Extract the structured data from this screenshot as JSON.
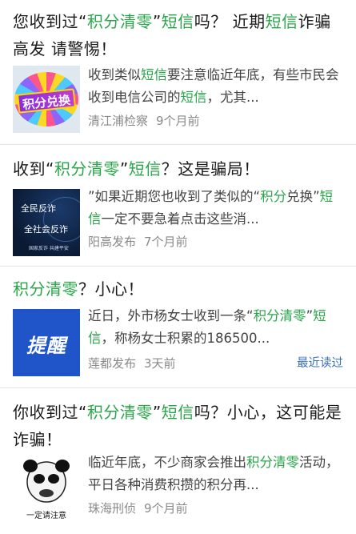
{
  "articles": [
    {
      "title_parts": [
        {
          "text": "您收到过“",
          "hl": false
        },
        {
          "text": "积分清零",
          "hl": true
        },
        {
          "text": "”",
          "hl": false
        },
        {
          "text": "短信",
          "hl": true
        },
        {
          "text": "吗？ 近期",
          "hl": false
        },
        {
          "text": "短信",
          "hl": true
        },
        {
          "text": "诈骗高发 请警惕！",
          "hl": false
        }
      ],
      "thumb_text": "积分兑换",
      "snippet_parts": [
        {
          "text": "收到类似",
          "hl": false
        },
        {
          "text": "短信",
          "hl": true
        },
        {
          "text": "要注意临近年底，有些市民会收到电信公司的",
          "hl": false
        },
        {
          "text": "短信",
          "hl": true
        },
        {
          "text": "，尤其...",
          "hl": false
        }
      ],
      "source": "清江浦检察",
      "time": "9个月前"
    },
    {
      "title_parts": [
        {
          "text": "收到“",
          "hl": false
        },
        {
          "text": "积分清零",
          "hl": true
        },
        {
          "text": "”",
          "hl": false
        },
        {
          "text": "短信",
          "hl": true
        },
        {
          "text": "？这是骗局！",
          "hl": false
        }
      ],
      "thumb_line1": "全民反诈",
      "thumb_line2": "全社会反诈",
      "thumb_foot": "国家反诈  共建平安",
      "snippet_parts": [
        {
          "text": "”如果近期您也收到了类似的“",
          "hl": false
        },
        {
          "text": "积分",
          "hl": true
        },
        {
          "text": "兑换",
          "hl": false
        },
        {
          "text": "”",
          "hl": false
        },
        {
          "text": "短信",
          "hl": true
        },
        {
          "text": "一定不要急着点击这些消...",
          "hl": false
        }
      ],
      "source": "阳高发布",
      "time": "7个月前"
    },
    {
      "title_parts": [
        {
          "text": "积分清零",
          "hl": true
        },
        {
          "text": "？小心！",
          "hl": false
        }
      ],
      "thumb_text": "提醒",
      "snippet_parts": [
        {
          "text": "近日，外市杨女士收到一条“",
          "hl": false
        },
        {
          "text": "积分清零",
          "hl": true
        },
        {
          "text": "”",
          "hl": false
        },
        {
          "text": "短信",
          "hl": true
        },
        {
          "text": "，称杨女士积累的186500...",
          "hl": false
        }
      ],
      "source": "莲都发布",
      "time": "3天前",
      "badge": "最近读过"
    },
    {
      "title_parts": [
        {
          "text": "你收到过“",
          "hl": false
        },
        {
          "text": "积分清零",
          "hl": true
        },
        {
          "text": "”",
          "hl": false
        },
        {
          "text": "短信",
          "hl": true
        },
        {
          "text": "吗？小心，这可能是诈骗！",
          "hl": false
        }
      ],
      "thumb_caption": "一定请注意",
      "snippet_parts": [
        {
          "text": "临近年底，不少商家会推出",
          "hl": false
        },
        {
          "text": "积分清零",
          "hl": true
        },
        {
          "text": "活动，平日各种消费积攒的积分再...",
          "hl": false
        }
      ],
      "source": "珠海刑侦",
      "time": "9个月前"
    }
  ],
  "colors": {
    "highlight": "#2aa64a",
    "meta": "#8a8a8a",
    "badge": "#3a6fc4",
    "divider": "#e6e6e6"
  },
  "icons": [
    "points-exchange-thumbnail",
    "anti-fraud-thumbnail",
    "reminder-thumbnail",
    "panda-meme-thumbnail"
  ]
}
